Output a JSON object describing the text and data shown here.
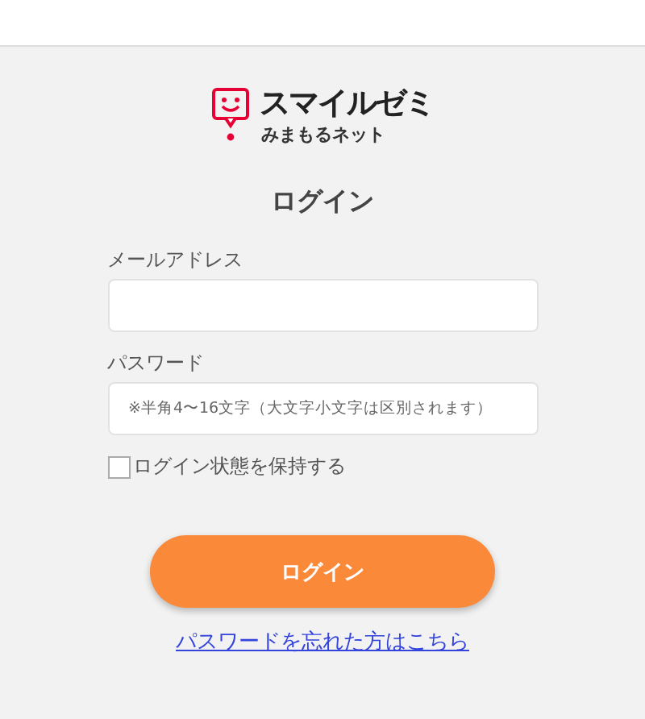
{
  "logo": {
    "brand": "スマイルゼミ",
    "subtitle": "みまもるネット"
  },
  "title": "ログイン",
  "fields": [
    {
      "label": "メールアドレス"
    },
    {
      "label": "パスワード",
      "placeholder": "※半角4〜16文字（大文字小文字は区別されます）"
    }
  ],
  "remember": {
    "label": "ログイン状態を保持する",
    "checked": false
  },
  "submit": "ログイン",
  "forgot_link": "パスワードを忘れた方はこちら"
}
